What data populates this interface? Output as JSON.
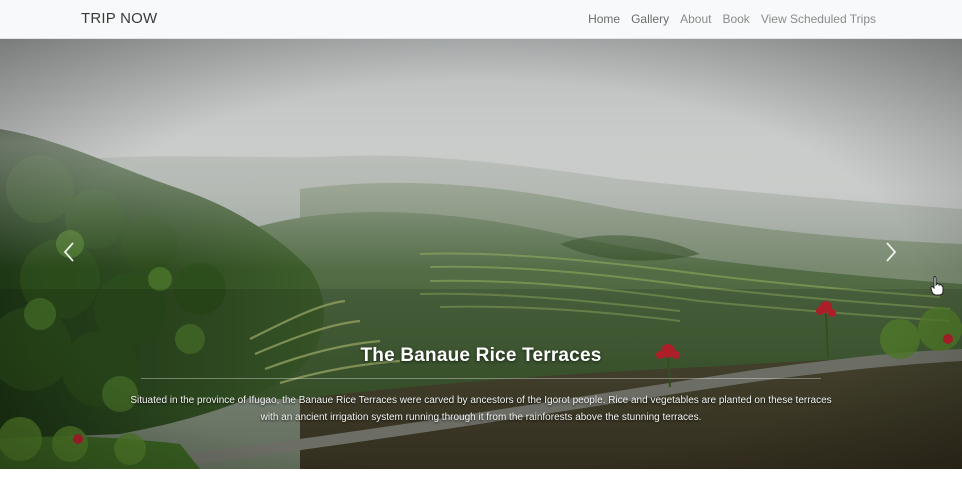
{
  "navbar": {
    "brand": "TRIP NOW",
    "links": [
      {
        "label": "Home"
      },
      {
        "label": "Gallery"
      },
      {
        "label": "About"
      },
      {
        "label": "Book"
      },
      {
        "label": "View Scheduled Trips"
      }
    ]
  },
  "carousel": {
    "slide": {
      "title": "The Banaue Rice Terraces",
      "description": "Situated in the province of Ifugao, the Banaue Rice Terraces were carved by ancestors of the Igorot people. Rice and vegetables are planted on these terraces with an ancient irrigation system running through it from the rainforests above the stunning terraces."
    },
    "prev_icon": "chevron-left-icon",
    "next_icon": "chevron-right-icon"
  },
  "colors": {
    "navbar_bg": "#f8f9fa",
    "brand_text": "#3a3a3a",
    "nav_link": "#8a8a8a",
    "mist": "#c9cbcb",
    "forest": "#2f4a22"
  }
}
